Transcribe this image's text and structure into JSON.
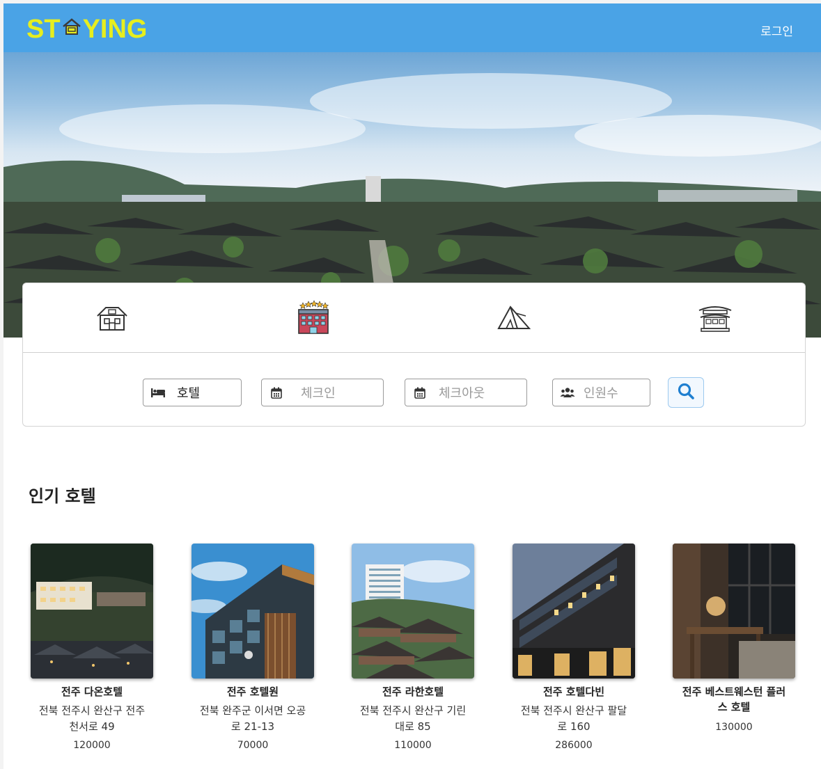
{
  "header": {
    "logo_left": "ST",
    "logo_right": "YING",
    "login_label": "로그인",
    "brand_color": "#e6ee1f",
    "bar_color": "#4aa3e6"
  },
  "categories": [
    {
      "icon": "house-icon"
    },
    {
      "icon": "hotel-icon"
    },
    {
      "icon": "tent-icon"
    },
    {
      "icon": "hanok-icon"
    }
  ],
  "search": {
    "type_value": "호텔",
    "checkin_placeholder": "체크인",
    "checkout_placeholder": "체크아웃",
    "guests_placeholder": "인원수",
    "search_icon": "search-icon"
  },
  "section": {
    "title": "인기 호텔"
  },
  "hotels": [
    {
      "name": "전주 다온호텔",
      "addr_line1": "전북 전주시 완산구 전주",
      "addr_line2": "천서로 49",
      "price": "120000"
    },
    {
      "name": "전주 호텔원",
      "addr_line1": "전북 완주군 이서면 오공",
      "addr_line2": "로 21-13",
      "price": "70000"
    },
    {
      "name": "전주 라한호텔",
      "addr_line1": "전북 전주시 완산구 기린",
      "addr_line2": "대로 85",
      "price": "110000"
    },
    {
      "name": "전주 호텔다빈",
      "addr_line1": "전북 전주시 완산구 팔달",
      "addr_line2": "로 160",
      "price": "286000"
    },
    {
      "name_line1": "전주 베스트웨스턴 플러",
      "name_line2": "스 호텔",
      "price": "130000"
    }
  ]
}
